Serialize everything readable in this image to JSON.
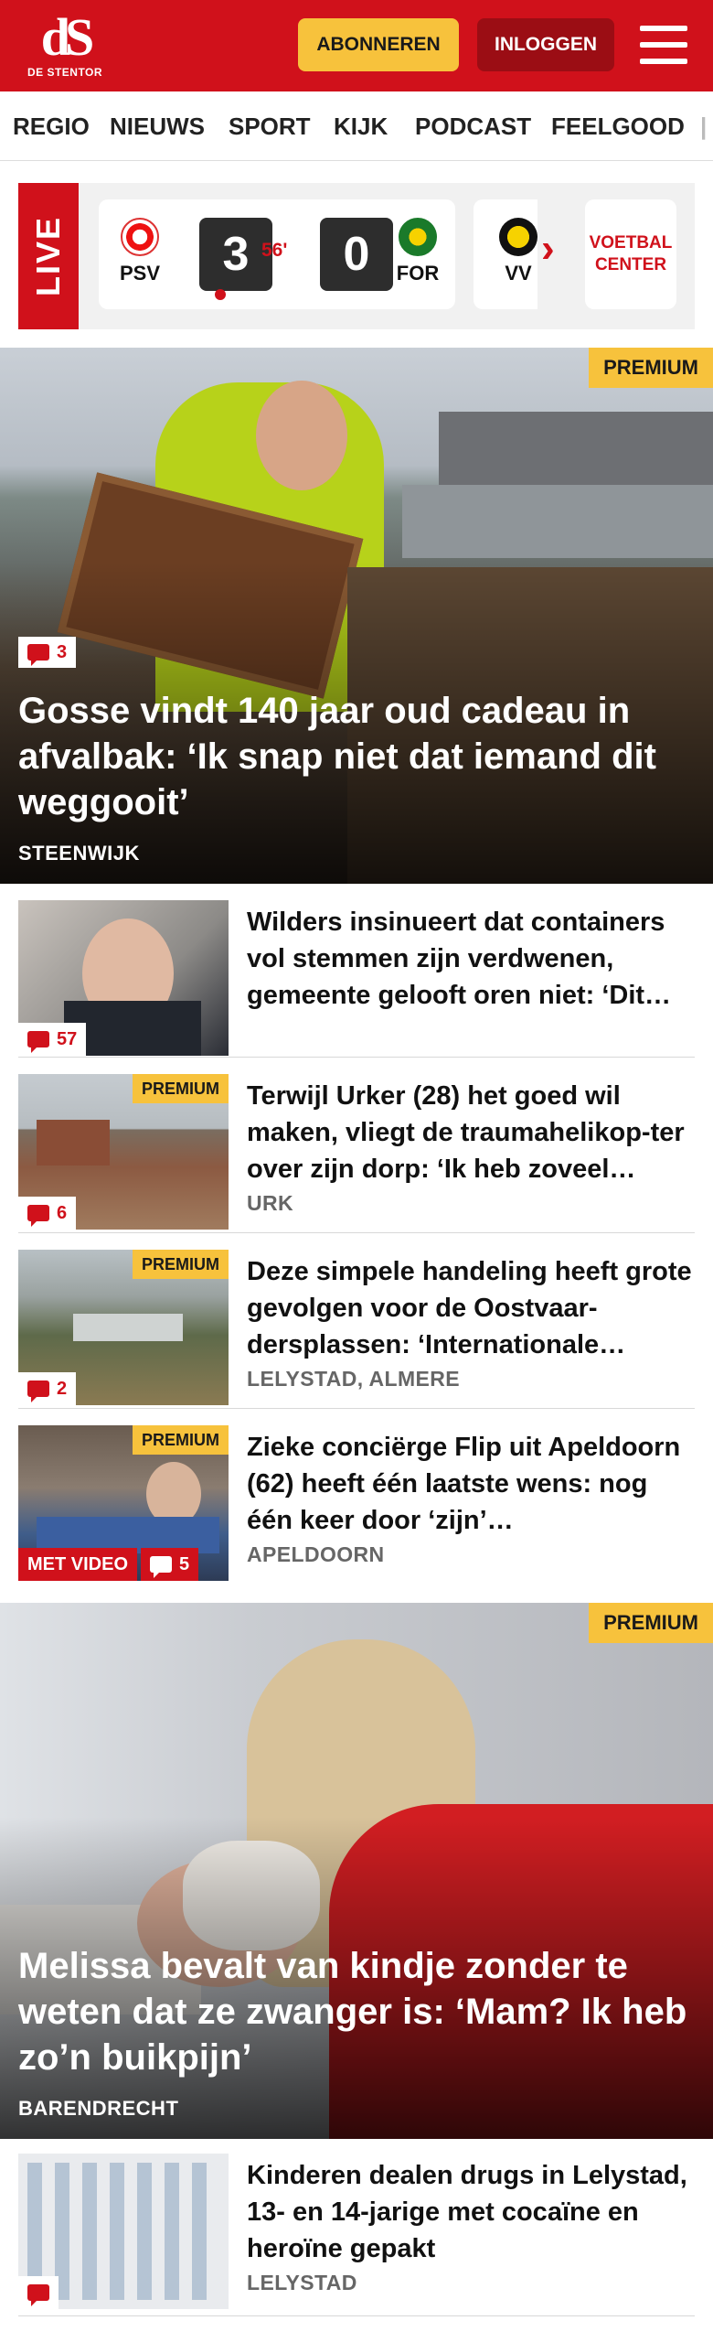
{
  "header": {
    "logo_mark": "dS",
    "logo_text": "DE STENTOR",
    "subscribe_label": "ABONNEREN",
    "login_label": "INLOGGEN"
  },
  "nav": {
    "items": [
      "REGIO",
      "NIEUWS",
      "SPORT",
      "KIJK",
      "PODCAST",
      "FEELGOOD"
    ]
  },
  "live": {
    "label": "LIVE",
    "home_team": "PSV",
    "home_score": "3",
    "minute": "56'",
    "away_score": "0",
    "away_team": "FOR",
    "next_team": "VV",
    "voetbal_center_line1": "VOETBAL",
    "voetbal_center_line2": "CENTER"
  },
  "hero1": {
    "premium": "PREMIUM",
    "comments": "3",
    "title": "Gosse vindt 140 jaar oud cadeau in afvalbak: ‘Ik snap niet dat iemand dit weggooit’",
    "location": "STEENWIJK"
  },
  "articles": [
    {
      "title": "Wilders insinueert dat containers vol stemmen zijn verdwenen, gemeente gelooft oren niet: ‘Dit…",
      "comments": "57",
      "premium": "",
      "video": "",
      "location": ""
    },
    {
      "title": "Terwijl Urker (28) het goed wil maken, vliegt de traumahelikop-ter over zijn dorp: ‘Ik heb zoveel…",
      "comments": "6",
      "premium": "PREMIUM",
      "video": "",
      "location": "URK"
    },
    {
      "title": "Deze simpele handeling heeft grote gevolgen voor de Oostvaar-dersplassen: ‘Internationale…",
      "comments": "2",
      "premium": "PREMIUM",
      "video": "",
      "location": "LELYSTAD, ALMERE"
    },
    {
      "title": "Zieke conciërge Flip uit Apeldoorn (62) heeft één laatste wens: nog één keer door ‘zijn’…",
      "comments": "5",
      "premium": "PREMIUM",
      "video": "MET VIDEO",
      "location": "APELDOORN"
    }
  ],
  "hero2": {
    "premium": "PREMIUM",
    "title": "Melissa bevalt van kindje zonder te weten dat ze zwanger is: ‘Mam? Ik heb zo’n buikpijn’",
    "location": "BARENDRECHT"
  },
  "article_last": {
    "title": "Kinderen dealen drugs in Lelystad, 13- en 14-jarige met cocaïne en heroïne gepakt",
    "location": "LELYSTAD"
  },
  "colors": {
    "brand_red": "#d0111b",
    "premium_yellow": "#f7c23c",
    "login_dark_red": "#9b0d14"
  }
}
